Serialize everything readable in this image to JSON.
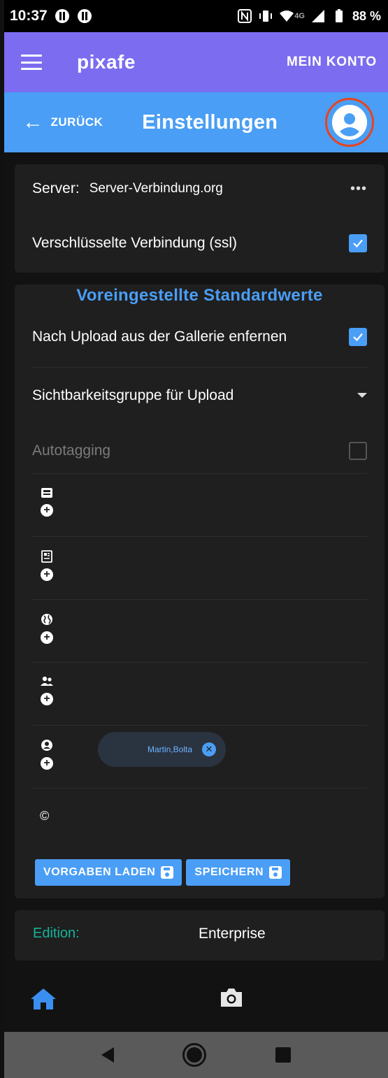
{
  "status_bar": {
    "time": "10:37",
    "network": "4G",
    "battery": "88 %"
  },
  "app_bar": {
    "brand": "pixafe",
    "account_label": "MEIN KONTO"
  },
  "toolbar": {
    "back_label": "ZURÜCK",
    "title": "Einstellungen"
  },
  "server_card": {
    "server_label": "Server:",
    "server_value": "Server-Verbindung.org",
    "ssl_label": "Verschlüsselte Verbindung (ssl)",
    "ssl_checked": true
  },
  "defaults_card": {
    "title": "Voreingestellte Standardwerte",
    "remove_after_upload_label": "Nach Upload aus der Gallerie enfernen",
    "remove_after_upload_checked": true,
    "visibility_group_label": "Sichtbarkeitsgruppe für Upload",
    "autotagging_label": "Autotagging",
    "autotagging_checked": false,
    "icon_rows": [
      "inbox-icon",
      "newspaper-icon",
      "globe-icon",
      "users-icon",
      "user-icon",
      "copyright-icon"
    ],
    "user_chip": "Martin,Bolta",
    "copyright_symbol": "©",
    "load_defaults_label": "VORGABEN LADEN",
    "save_label": "SPEICHERN"
  },
  "edition": {
    "label": "Edition:",
    "value": "Enterprise"
  },
  "colors": {
    "app_bar": "#7b6cf0",
    "toolbar": "#4a9ef5",
    "accent": "#4a9ef5",
    "edition_label": "#14b39a",
    "avatar_ring": "#e8431f"
  }
}
